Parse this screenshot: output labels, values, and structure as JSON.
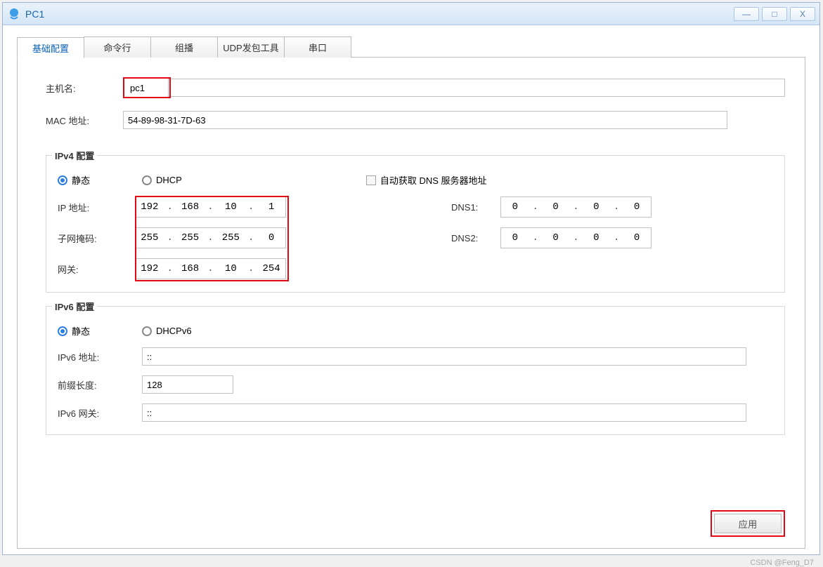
{
  "window": {
    "title": "PC1",
    "buttons": {
      "minimize": "—",
      "maximize": "□",
      "close": "X"
    }
  },
  "tabs": {
    "basic": "基础配置",
    "cli": "命令行",
    "multicast": "组播",
    "udp": "UDP发包工具",
    "serial": "串口"
  },
  "basic": {
    "hostname_label": "主机名:",
    "hostname_value": "pc1",
    "mac_label": "MAC 地址:",
    "mac_value": "54-89-98-31-7D-63"
  },
  "ipv4": {
    "legend": "IPv4 配置",
    "static_label": "静态",
    "dhcp_label": "DHCP",
    "auto_dns_label": "自动获取 DNS 服务器地址",
    "ip_label": "IP 地址:",
    "ip_value": {
      "o1": "192",
      "o2": "168",
      "o3": "10",
      "o4": "1"
    },
    "mask_label": "子网掩码:",
    "mask_value": {
      "o1": "255",
      "o2": "255",
      "o3": "255",
      "o4": "0"
    },
    "gw_label": "网关:",
    "gw_value": {
      "o1": "192",
      "o2": "168",
      "o3": "10",
      "o4": "254"
    },
    "dns1_label": "DNS1:",
    "dns1_value": {
      "o1": "0",
      "o2": "0",
      "o3": "0",
      "o4": "0"
    },
    "dns2_label": "DNS2:",
    "dns2_value": {
      "o1": "0",
      "o2": "0",
      "o3": "0",
      "o4": "0"
    }
  },
  "ipv6": {
    "legend": "IPv6 配置",
    "static_label": "静态",
    "dhcp_label": "DHCPv6",
    "addr_label": "IPv6 地址:",
    "addr_value": "::",
    "prefix_label": "前缀长度:",
    "prefix_value": "128",
    "gw_label": "IPv6 网关:",
    "gw_value": "::"
  },
  "footer": {
    "apply_label": "应用",
    "watermark": "CSDN @Feng_D7"
  }
}
